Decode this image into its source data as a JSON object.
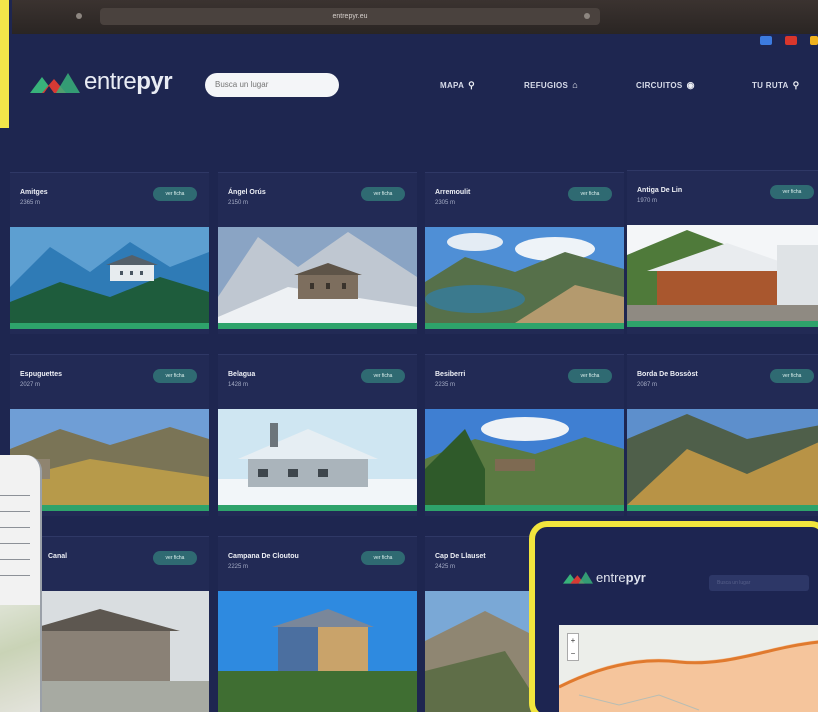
{
  "browser": {
    "url": "entrepyr.eu"
  },
  "header": {
    "logo": {
      "text_light": "entre",
      "text_bold": "pyr"
    },
    "search": {
      "placeholder": "Busca un lugar"
    },
    "nav": [
      {
        "label": "MAPA",
        "icon": "pin-icon",
        "glyph": "⚲"
      },
      {
        "label": "REFUGIOS",
        "icon": "home-icon",
        "glyph": "⌂"
      },
      {
        "label": "CIRCUITOS",
        "icon": "target-icon",
        "glyph": "◉"
      },
      {
        "label": "TU RUTA",
        "icon": "pin-icon",
        "glyph": "⚲"
      }
    ],
    "languages": [
      {
        "name": "lang-flag-blue",
        "color": "#3c7be0"
      },
      {
        "name": "lang-flag-red",
        "color": "#d8362c"
      },
      {
        "name": "lang-flag-yellow",
        "color": "#f0b21e"
      }
    ]
  },
  "cards_button_label": "ver ficha",
  "cards": [
    {
      "name": "Amitges",
      "altitude": "2365 m"
    },
    {
      "name": "Ángel Orús",
      "altitude": "2150 m"
    },
    {
      "name": "Arremoulit",
      "altitude": "2305 m"
    },
    {
      "name": "Antiga De Lin",
      "altitude": "1970 m"
    },
    {
      "name": "Espuguettes",
      "altitude": "2027 m"
    },
    {
      "name": "Belagua",
      "altitude": "1428 m"
    },
    {
      "name": "Besiberri",
      "altitude": "2235 m"
    },
    {
      "name": "Borda De Bossòst",
      "altitude": "2087 m"
    },
    {
      "name": "Canal",
      "altitude": ""
    },
    {
      "name": "Campana De Cloutou",
      "altitude": "2225 m"
    },
    {
      "name": "Cap De Llauset",
      "altitude": "2425 m"
    }
  ],
  "device": {
    "logo": {
      "text_light": "entre",
      "text_bold": "pyr"
    },
    "search_placeholder": "Busca un lugar",
    "zoom_in": "+",
    "zoom_out": "−"
  },
  "colors": {
    "background": "#1e2650",
    "card": "#222a55",
    "button": "#2f6a72",
    "accent_green": "#2ea36b",
    "logo_red": "#d63a34",
    "logo_green": "#38b27a",
    "frame_yellow": "#f2e53d"
  }
}
